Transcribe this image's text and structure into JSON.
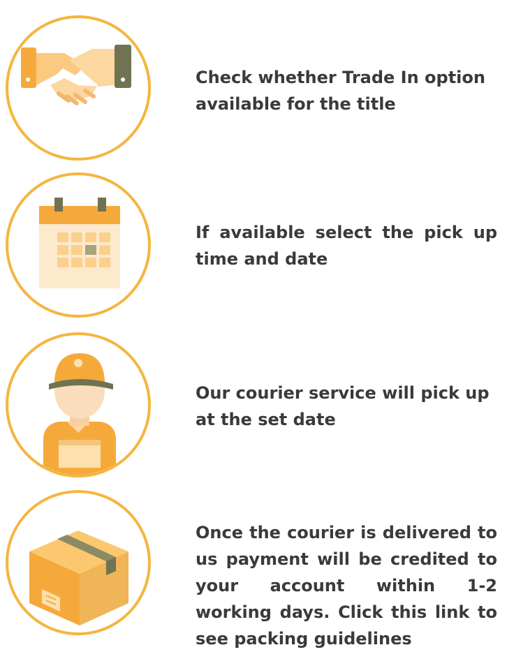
{
  "steps": [
    {
      "icon": "handshake-icon",
      "text": "Check whether Trade In option available for the title"
    },
    {
      "icon": "calendar-icon",
      "text": "If available select the pick up time and date"
    },
    {
      "icon": "courier-icon",
      "text": "Our courier service will pick up at the set date"
    },
    {
      "icon": "package-box-icon",
      "text": "Once the courier is delivered to us payment will be credited to your account within 1-2 working days. Click this link to see packing guidelines"
    }
  ],
  "colors": {
    "ring": "#f4b63e",
    "text": "#3a3a3a",
    "accent_orange": "#f6a93b",
    "accent_olive": "#6f7352"
  }
}
